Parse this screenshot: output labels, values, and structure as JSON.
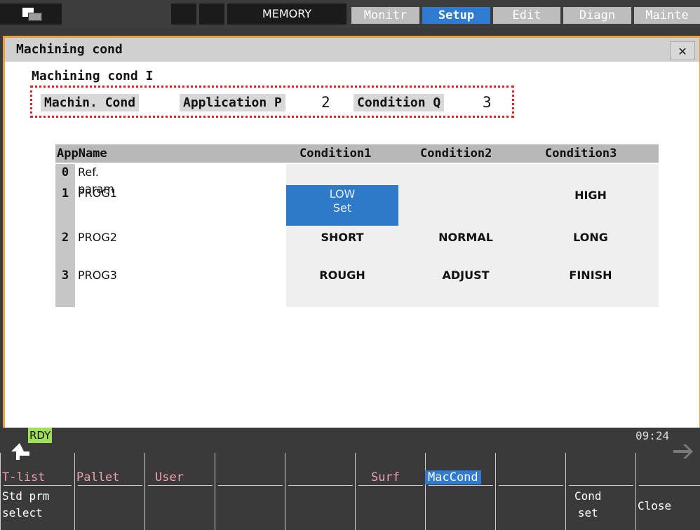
{
  "topbar": {
    "mode": "MEMORY",
    "tabs": [
      {
        "label": "Monitr",
        "active": false
      },
      {
        "label": "Setup",
        "active": true
      },
      {
        "label": "Edit",
        "active": false
      },
      {
        "label": "Diagn",
        "active": false
      },
      {
        "label": "Mainte",
        "active": false
      }
    ]
  },
  "window": {
    "title": "Machining cond",
    "close_label": "✕",
    "heading": "Machining cond I",
    "filter": {
      "machin_label": "Machin. Cond",
      "application_label": "Application P",
      "application_value": "2",
      "condition_label": "Condition Q",
      "condition_value": "3"
    },
    "table": {
      "headers": [
        "AppName",
        "Condition1",
        "Condition2",
        "Condition3"
      ],
      "rows": [
        {
          "index": "0",
          "name": "Ref. param",
          "c1": "",
          "c2": "",
          "c3": ""
        },
        {
          "index": "1",
          "name": "PROG1",
          "c1": "LOW",
          "c1_sub": "Set",
          "c2": "",
          "c3": "HIGH"
        },
        {
          "index": "2",
          "name": "PROG2",
          "c1": "SHORT",
          "c2": "NORMAL",
          "c3": "LONG"
        },
        {
          "index": "3",
          "name": "PROG3",
          "c1": "ROUGH",
          "c2": "ADJUST",
          "c3": "FINISH"
        }
      ]
    }
  },
  "status": {
    "rdy": "RDY",
    "time": "09:24"
  },
  "softkeys": [
    {
      "top": "T-list",
      "bottom": "Std prm\nselect"
    },
    {
      "top": "Pallet",
      "bottom": ""
    },
    {
      "top": "User",
      "bottom": ""
    },
    {
      "top": "",
      "bottom": ""
    },
    {
      "top": "",
      "bottom": ""
    },
    {
      "top": "Surf",
      "bottom": ""
    },
    {
      "top": "MacCond",
      "bottom": "",
      "active": true
    },
    {
      "top": "",
      "bottom": ""
    },
    {
      "top": "",
      "bottom": "Cond\nset"
    },
    {
      "top": "",
      "bottom": "Close"
    }
  ],
  "colors": {
    "accent": "#2e7bd1",
    "window_border": "#f0a030",
    "highlight_box": "#dd2222",
    "rdy": "#9fdf5a"
  }
}
